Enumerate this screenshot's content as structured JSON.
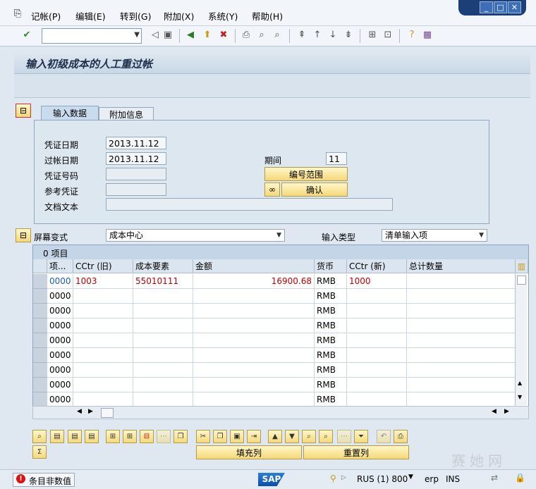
{
  "menu": [
    "记帐(P)",
    "编辑(E)",
    "转到(G)",
    "附加(X)",
    "系统(Y)",
    "帮助(H)"
  ],
  "page_title": "输入初级成本的人工重过帐",
  "tabs": [
    "输入数据",
    "附加信息"
  ],
  "form": {
    "doc_date_label": "凭证日期",
    "doc_date": "2013.11.12",
    "post_date_label": "过帐日期",
    "post_date": "2013.11.12",
    "doc_no_label": "凭证号码",
    "ref_doc_label": "参考凭证",
    "doc_text_label": "文档文本",
    "period_label": "期间",
    "period": "11",
    "number_range_btn": "编号范围",
    "confirm_btn": "确认"
  },
  "screen_variant": {
    "label": "屏幕变式",
    "value": "成本中心"
  },
  "input_type": {
    "label": "输入类型",
    "value": "清单输入项"
  },
  "table": {
    "title": "0 项目",
    "columns": [
      "项...",
      "CCtr (旧)",
      "成本要素",
      "金额",
      "货币",
      "CCtr (新)",
      "总计数量"
    ],
    "rows": [
      [
        "0000",
        "1003",
        "55010111",
        "16900.68",
        "RMB",
        "1000",
        ""
      ],
      [
        "0000",
        "",
        "",
        "",
        "RMB",
        "",
        ""
      ],
      [
        "0000",
        "",
        "",
        "",
        "RMB",
        "",
        ""
      ],
      [
        "0000",
        "",
        "",
        "",
        "RMB",
        "",
        ""
      ],
      [
        "0000",
        "",
        "",
        "",
        "RMB",
        "",
        ""
      ],
      [
        "0000",
        "",
        "",
        "",
        "RMB",
        "",
        ""
      ],
      [
        "0000",
        "",
        "",
        "",
        "RMB",
        "",
        ""
      ],
      [
        "0000",
        "",
        "",
        "",
        "RMB",
        "",
        ""
      ],
      [
        "0000",
        "",
        "",
        "",
        "RMB",
        "",
        ""
      ]
    ]
  },
  "bottom_buttons": {
    "fill_col": "填充列",
    "reset_col": "重置列"
  },
  "status": {
    "message": "条目非数值",
    "logo": "SAP",
    "system": "RUS (1) 800",
    "server": "erp",
    "mode": "INS"
  },
  "watermark": "赛她网"
}
